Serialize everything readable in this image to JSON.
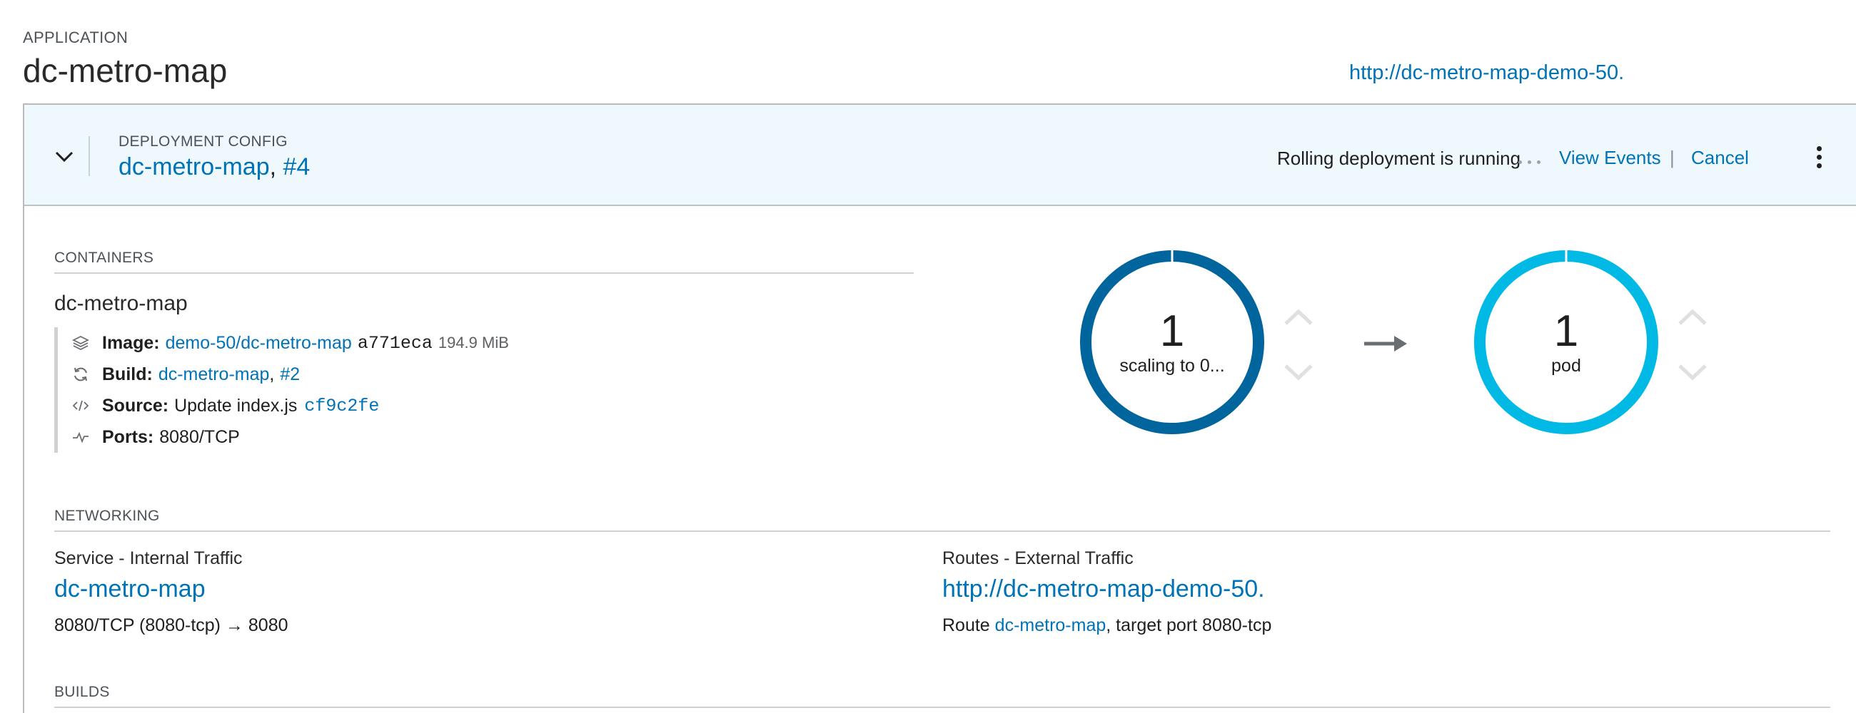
{
  "application": {
    "label": "APPLICATION",
    "name": "dc-metro-map",
    "route_url": "http://dc-metro-map-demo-50."
  },
  "deployment_config": {
    "label": "DEPLOYMENT CONFIG",
    "name": "dc-metro-map",
    "separator": ",",
    "revision": "#4",
    "status_text": "Rolling deployment is running",
    "view_events": "View Events",
    "divider": "|",
    "cancel": "Cancel"
  },
  "containers": {
    "heading": "CONTAINERS",
    "name": "dc-metro-map",
    "image_label": "Image:",
    "image_link": "demo-50/dc-metro-map",
    "image_hash": "a771eca",
    "image_size": "194.9 MiB",
    "build_label": "Build:",
    "build_link": "dc-metro-map",
    "build_separator": ",",
    "build_number": "#2",
    "source_label": "Source:",
    "source_text": "Update index.js",
    "source_commit": "cf9c2fe",
    "ports_label": "Ports:",
    "ports_value": "8080/TCP"
  },
  "scaling": {
    "old": {
      "count": "1",
      "label": "scaling to 0...",
      "color": "#00659c"
    },
    "new": {
      "count": "1",
      "label": "pod",
      "color": "#00b9e4"
    },
    "arrow_color": "#6a6e73",
    "chevron_color": "#d1d1d1"
  },
  "networking": {
    "heading": "NETWORKING",
    "service_heading": "Service - Internal Traffic",
    "service_name": "dc-metro-map",
    "service_ports": "8080/TCP (8080-tcp) → 8080",
    "routes_heading": "Routes - External Traffic",
    "route_url": "http://dc-metro-map-demo-50.",
    "route_prefix": "Route",
    "route_link": "dc-metro-map",
    "route_suffix": ", target port 8080-tcp"
  },
  "builds": {
    "heading": "BUILDS"
  },
  "colors": {
    "link": "#0073b6",
    "header_bg": "#eef8fd"
  }
}
